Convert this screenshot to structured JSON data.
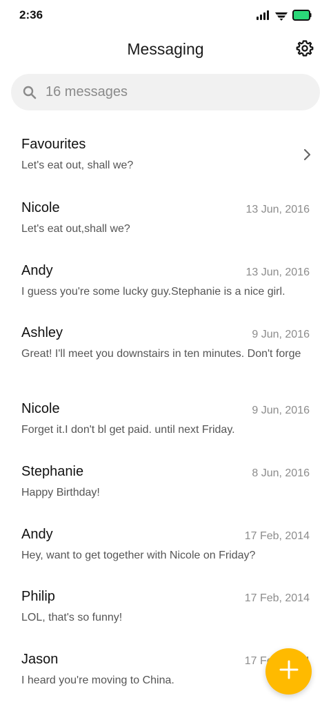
{
  "status_bar": {
    "time": "2:36",
    "icons": [
      "signal-icon",
      "wifi-icon",
      "battery-icon"
    ],
    "battery_color": "#2bd879"
  },
  "header": {
    "title": "Messaging",
    "settings_icon": "gear-icon"
  },
  "search": {
    "placeholder": "16 messages",
    "icon": "search-icon"
  },
  "favourites": {
    "name": "Favourites",
    "preview": "Let's eat out, shall we?",
    "icon": "chevron-right-icon"
  },
  "conversations": [
    {
      "name": "Nicole",
      "date": "13 Jun, 2016",
      "preview": "Let's eat out,shall we?"
    },
    {
      "name": "Andy",
      "date": "13 Jun, 2016",
      "preview": "I guess you're some lucky guy.Stephanie is a nice girl."
    },
    {
      "name": "Ashley",
      "date": "9 Jun, 2016",
      "preview": "Great! I'll meet you downstairs in ten minutes. Don't forge"
    },
    {
      "name": "Nicole",
      "date": "9 Jun, 2016",
      "preview": "Forget it.I don't bl get paid. until next Friday."
    },
    {
      "name": "Stephanie",
      "date": "8 Jun, 2016",
      "preview": "Happy Birthday!"
    },
    {
      "name": "Andy",
      "date": "17 Feb, 2014",
      "preview": "Hey, want to get together with Nicole on Friday?"
    },
    {
      "name": "Philip",
      "date": "17 Feb, 2014",
      "preview": "LOL, that's so funny!"
    },
    {
      "name": "Jason",
      "date": "17 Feb, 2014",
      "preview": "I heard you're moving to China."
    }
  ],
  "fab": {
    "icon": "plus-icon",
    "color": "#ffba00"
  }
}
